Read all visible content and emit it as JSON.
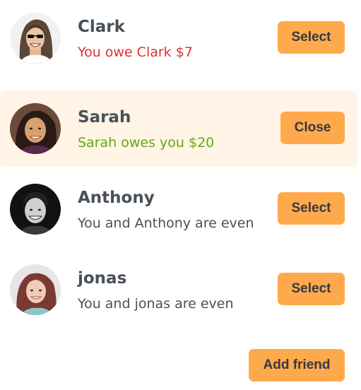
{
  "friends": [
    {
      "name": "Clark",
      "status": "You owe Clark $7",
      "balance_type": "owe",
      "button_label": "Select",
      "selected": false,
      "avatar_icon": "avatar-clark"
    },
    {
      "name": "Sarah",
      "status": "Sarah owes you $20",
      "balance_type": "owed",
      "button_label": "Close",
      "selected": true,
      "avatar_icon": "avatar-sarah"
    },
    {
      "name": "Anthony",
      "status": "You and Anthony are even",
      "balance_type": "even",
      "button_label": "Select",
      "selected": false,
      "avatar_icon": "avatar-anthony"
    },
    {
      "name": "jonas",
      "status": "You and jonas are even",
      "balance_type": "even",
      "button_label": "Select",
      "selected": false,
      "avatar_icon": "avatar-jonas"
    }
  ],
  "add_friend_label": "Add friend",
  "colors": {
    "accent": "#ffa94d",
    "selected_background": "#fff4e6",
    "owe_text": "#e03131",
    "owed_text": "#66a80f",
    "neutral_text": "#495057"
  }
}
